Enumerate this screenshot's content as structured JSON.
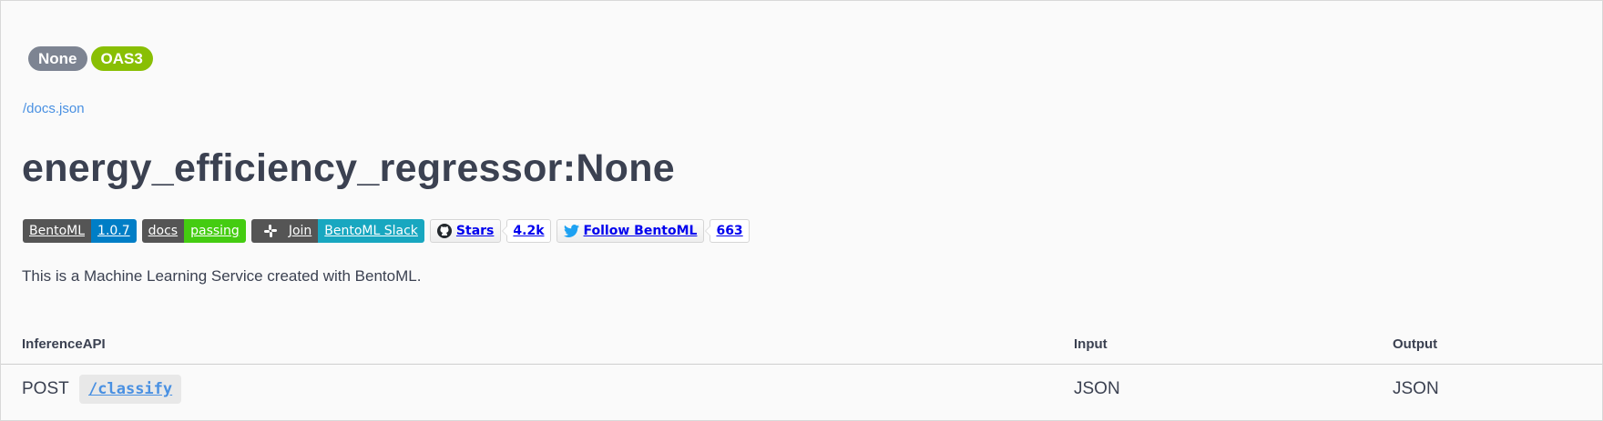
{
  "header": {
    "version_badge": "None",
    "oas_badge": "OAS3",
    "docs_link": "/docs.json",
    "title": "energy_efficiency_regressor:None"
  },
  "badges": {
    "bentoml_label": "BentoML",
    "bentoml_version": "1.0.7",
    "docs_label": "docs",
    "docs_status": "passing",
    "join_label": "Join",
    "slack_label": "BentoML Slack",
    "stars_label": "Stars",
    "stars_count": "4.2k",
    "follow_label": "Follow BentoML",
    "follow_count": "663"
  },
  "description": "This is a Machine Learning Service created with BentoML.",
  "table": {
    "headers": [
      "InferenceAPI",
      "Input",
      "Output"
    ],
    "rows": [
      {
        "method": "POST",
        "path": "/classify",
        "input": "JSON",
        "output": "JSON"
      }
    ]
  },
  "colors": {
    "version_badge": "#7d8492",
    "oas_badge": "#89bf04",
    "link": "#4990e2",
    "text": "#3b4151"
  }
}
